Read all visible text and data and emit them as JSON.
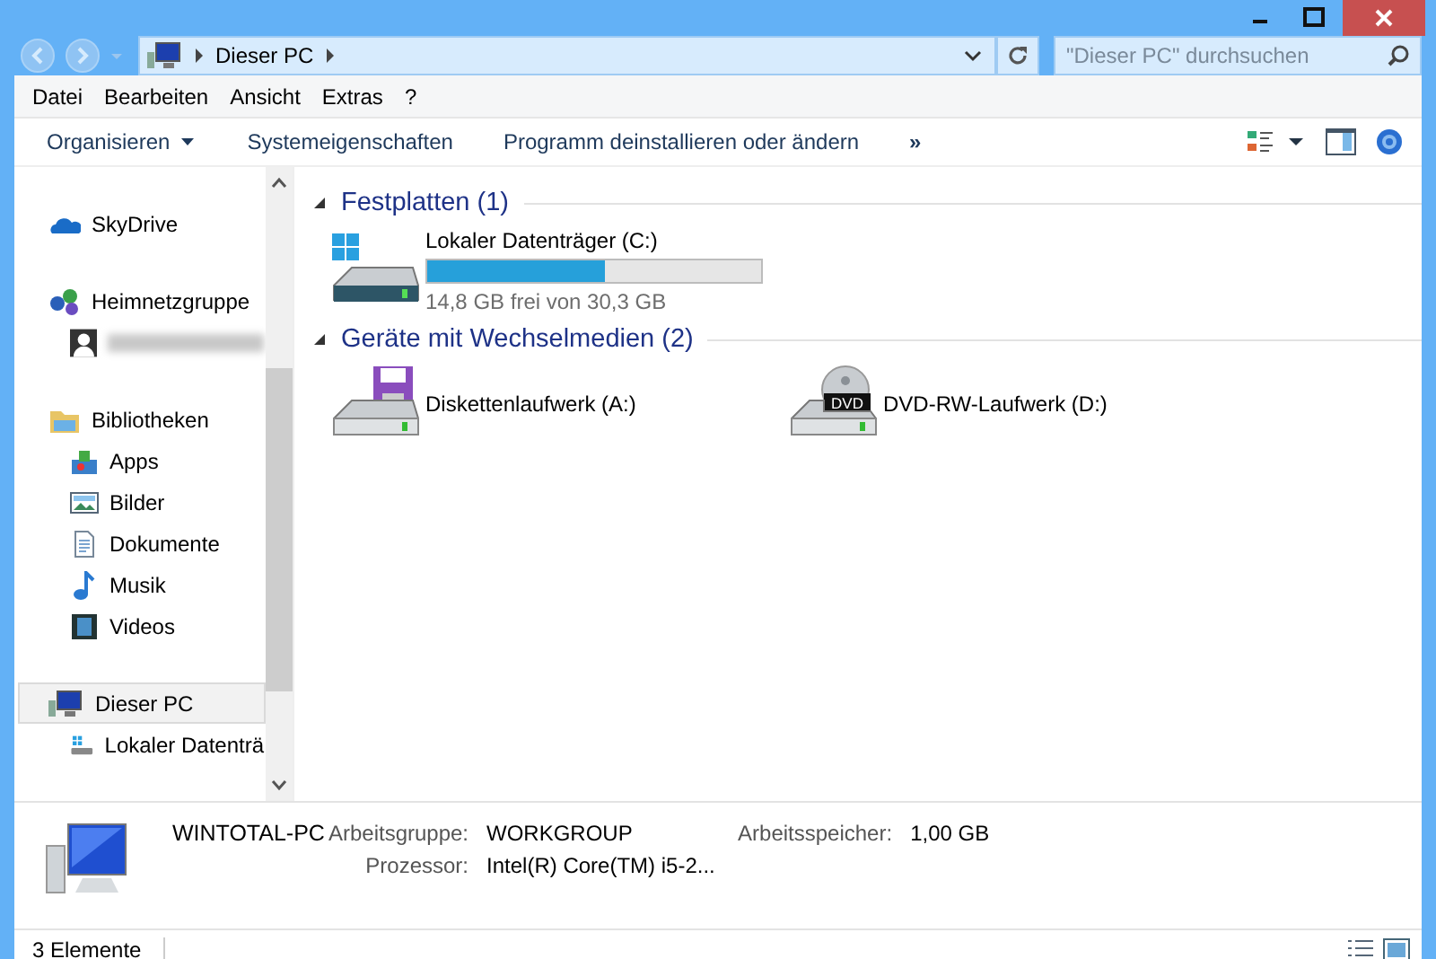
{
  "address": {
    "crumbs": [
      "Dieser PC"
    ]
  },
  "search": {
    "placeholder": "\"Dieser PC\" durchsuchen"
  },
  "menu": [
    "Datei",
    "Bearbeiten",
    "Ansicht",
    "Extras",
    "?"
  ],
  "commands": [
    {
      "label": "Organisieren",
      "kind": "dropdown"
    },
    {
      "label": "Systemeigenschaften",
      "kind": "plain"
    },
    {
      "label": "Programm deinstallieren oder ändern",
      "kind": "plain"
    },
    {
      "label": "»",
      "kind": "more"
    }
  ],
  "sidebar": {
    "items": [
      {
        "label": "SkyDrive",
        "selected": false
      },
      {
        "label": "Heimnetzgruppe",
        "selected": false,
        "children": [
          {
            "kind": "redacted",
            "selected": false
          }
        ]
      },
      {
        "label": "Bibliotheken",
        "selected": false,
        "children": [
          {
            "kind": "entry",
            "label": "Apps",
            "selected": false
          },
          {
            "kind": "entry",
            "label": "Bilder",
            "selected": false
          },
          {
            "kind": "entry",
            "label": "Dokumente",
            "selected": false
          },
          {
            "kind": "entry",
            "label": "Musik",
            "selected": false
          },
          {
            "kind": "entry",
            "label": "Videos",
            "selected": false
          }
        ]
      },
      {
        "label": "Dieser PC",
        "selected": true,
        "children": [
          {
            "kind": "entry",
            "label": "Lokaler Datenträ",
            "selected": false
          }
        ]
      }
    ]
  },
  "groups": [
    {
      "title": "Festplatten (1)",
      "expanded": true,
      "items": [
        {
          "kind": "disk",
          "name": "Lokaler Datenträger (C:)",
          "level": 0.53,
          "free": "14,8 GB frei von 30,3 GB"
        }
      ]
    },
    {
      "title": "Geräte mit Wechselmedien (2)",
      "expanded": true,
      "items": [
        {
          "kind": "floppy",
          "name": "Diskettenlaufwerk (A:)"
        },
        {
          "kind": "dvd",
          "name": "DVD-RW-Laufwerk (D:)",
          "badge": "DVD"
        }
      ]
    }
  ],
  "details": {
    "name": "WINTOTAL-PC",
    "fields": [
      {
        "label": "Arbeitsgruppe:",
        "value": "WORKGROUP"
      },
      {
        "label": "Arbeitsspeicher:",
        "value": "1,00 GB"
      },
      {
        "label": "Prozessor:",
        "value": "Intel(R) Core(TM) i5-2..."
      }
    ]
  },
  "status_bar": {
    "count": "3 Elemente"
  }
}
